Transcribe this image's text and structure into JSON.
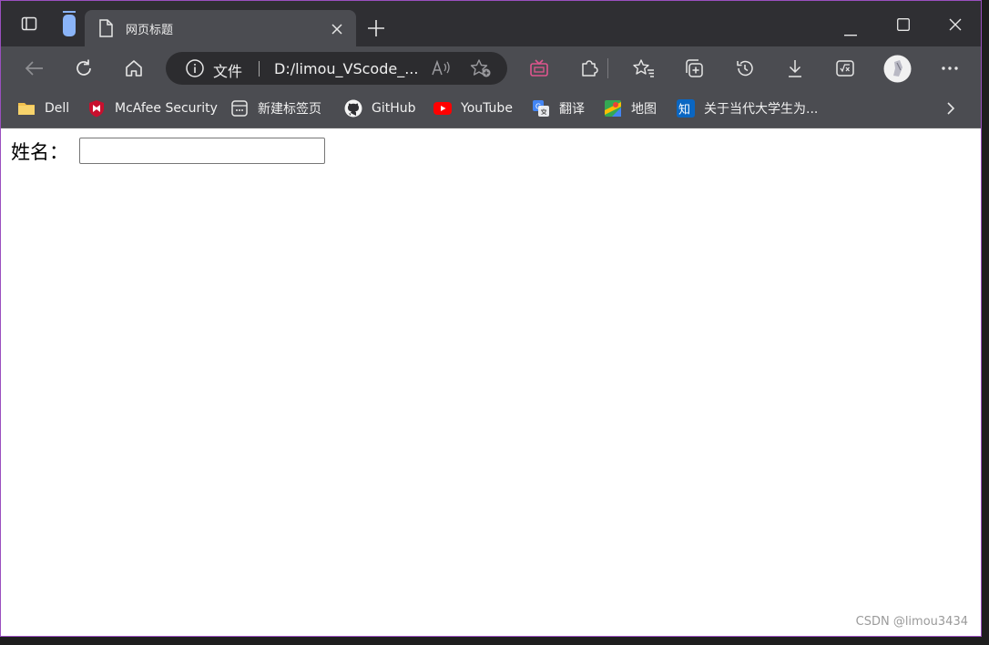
{
  "browser": {
    "tab": {
      "title": "网页标题",
      "icon": "page-icon"
    },
    "address": {
      "scheme_label": "文件",
      "url": "D:/limou_VScode_..."
    },
    "colors": {
      "chrome_dark": "#2f2f33",
      "chrome": "#4b4c51",
      "address_bg": "#2c2c2f",
      "accent_tab": "#8ab4f8"
    }
  },
  "bookmarks": [
    {
      "label": "Dell",
      "icon": "folder-icon"
    },
    {
      "label": "McAfee Security",
      "icon": "mcafee-shield-icon"
    },
    {
      "label": "新建标签页",
      "icon": "new-tab-page-icon"
    },
    {
      "label": "GitHub",
      "icon": "github-icon"
    },
    {
      "label": "YouTube",
      "icon": "youtube-icon"
    },
    {
      "label": "翻译",
      "icon": "translate-icon"
    },
    {
      "label": "地图",
      "icon": "maps-icon"
    },
    {
      "label": "关于当代大学生为...",
      "icon": "zhihu-icon"
    }
  ],
  "page": {
    "name_label": "姓名：",
    "name_value": ""
  },
  "watermark": "CSDN @limou3434"
}
